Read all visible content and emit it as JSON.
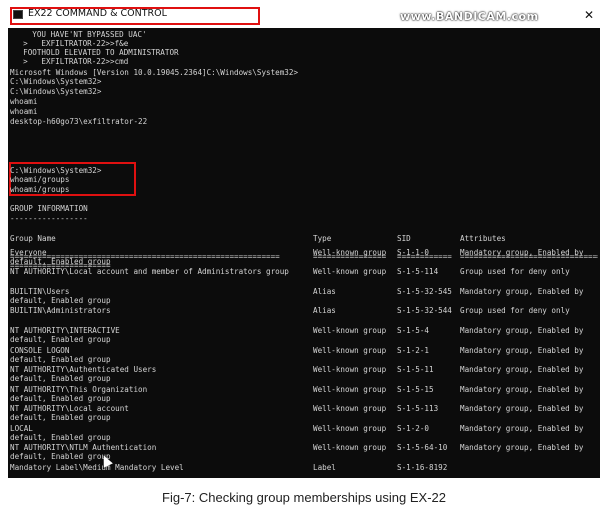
{
  "window": {
    "title": "EX22 COMMAND & CONTROL",
    "watermark": "www.BANDICAM.com",
    "close_glyph": "✕"
  },
  "console": {
    "intro_lines": [
      "    YOU HAVE'NT BYPASSED UAC'",
      "  >   EXFILTRATOR-22>>f&e",
      "  FOOTHOLD ELEVATED TO ADMINISTRATOR",
      "  >   EXFILTRATOR-22>>cmd",
      "Microsoft Windows [Version 10.0.19045.2364]C:\\Windows\\System32>",
      "C:\\Windows\\System32>",
      "C:\\Windows\\System32>",
      "whoami",
      "whoami",
      "desktop-h60go73\\exfiltrator-22"
    ],
    "command_lines": [
      "C:\\Windows\\System32>",
      "whoami/groups",
      "whoami/groups"
    ],
    "section_title": "GROUP INFORMATION",
    "section_rule": "-----------------",
    "headers": {
      "name": "Group Name",
      "type": "Type",
      "sid": "SID",
      "attributes": "Attributes"
    },
    "rules": {
      "name": "===========================================================",
      "type": "================",
      "sid": "============",
      "attributes": "==================================="
    },
    "rule_tail": "======================",
    "rows": [
      {
        "name": "Everyone",
        "type": "Well-known group",
        "sid": "S-1-1-0",
        "attr": "Mandatory group, Enabled by",
        "cont": "default, Enabled group"
      },
      {
        "name": "NT AUTHORITY\\Local account and member of Administrators group",
        "type": "Well-known group",
        "sid": "S-1-5-114",
        "attr": "Group used for deny only",
        "cont": ""
      },
      {
        "name": "BUILTIN\\Users",
        "type": "Alias",
        "sid": "S-1-5-32-545",
        "attr": "Mandatory group, Enabled by",
        "cont": "default, Enabled group"
      },
      {
        "name": "BUILTIN\\Administrators",
        "type": "Alias",
        "sid": "S-1-5-32-544",
        "attr": "Group used for deny only",
        "cont": ""
      },
      {
        "name": "NT AUTHORITY\\INTERACTIVE",
        "type": "Well-known group",
        "sid": "S-1-5-4",
        "attr": "Mandatory group, Enabled by",
        "cont": "default, Enabled group"
      },
      {
        "name": "CONSOLE LOGON",
        "type": "Well-known group",
        "sid": "S-1-2-1",
        "attr": "Mandatory group, Enabled by",
        "cont": "default, Enabled group"
      },
      {
        "name": "NT AUTHORITY\\Authenticated Users",
        "type": "Well-known group",
        "sid": "S-1-5-11",
        "attr": "Mandatory group, Enabled by",
        "cont": "default, Enabled group"
      },
      {
        "name": "NT AUTHORITY\\This Organization",
        "type": "Well-known group",
        "sid": "S-1-5-15",
        "attr": "Mandatory group, Enabled by",
        "cont": "default, Enabled group"
      },
      {
        "name": "NT AUTHORITY\\Local account",
        "type": "Well-known group",
        "sid": "S-1-5-113",
        "attr": "Mandatory group, Enabled by",
        "cont": "default, Enabled group"
      },
      {
        "name": "LOCAL",
        "type": "Well-known group",
        "sid": "S-1-2-0",
        "attr": "Mandatory group, Enabled by",
        "cont": "default, Enabled group"
      },
      {
        "name": "NT AUTHORITY\\NTLM Authentication",
        "type": "Well-known group",
        "sid": "S-1-5-64-10",
        "attr": "Mandatory group, Enabled by",
        "cont": "default, Enabled group"
      },
      {
        "name": "Mandatory Label\\Medium Mandatory Level",
        "type": "Label",
        "sid": "S-1-16-8192",
        "attr": "",
        "cont": ""
      }
    ]
  },
  "caption": "Fig-7: Checking group memberships using EX-22"
}
